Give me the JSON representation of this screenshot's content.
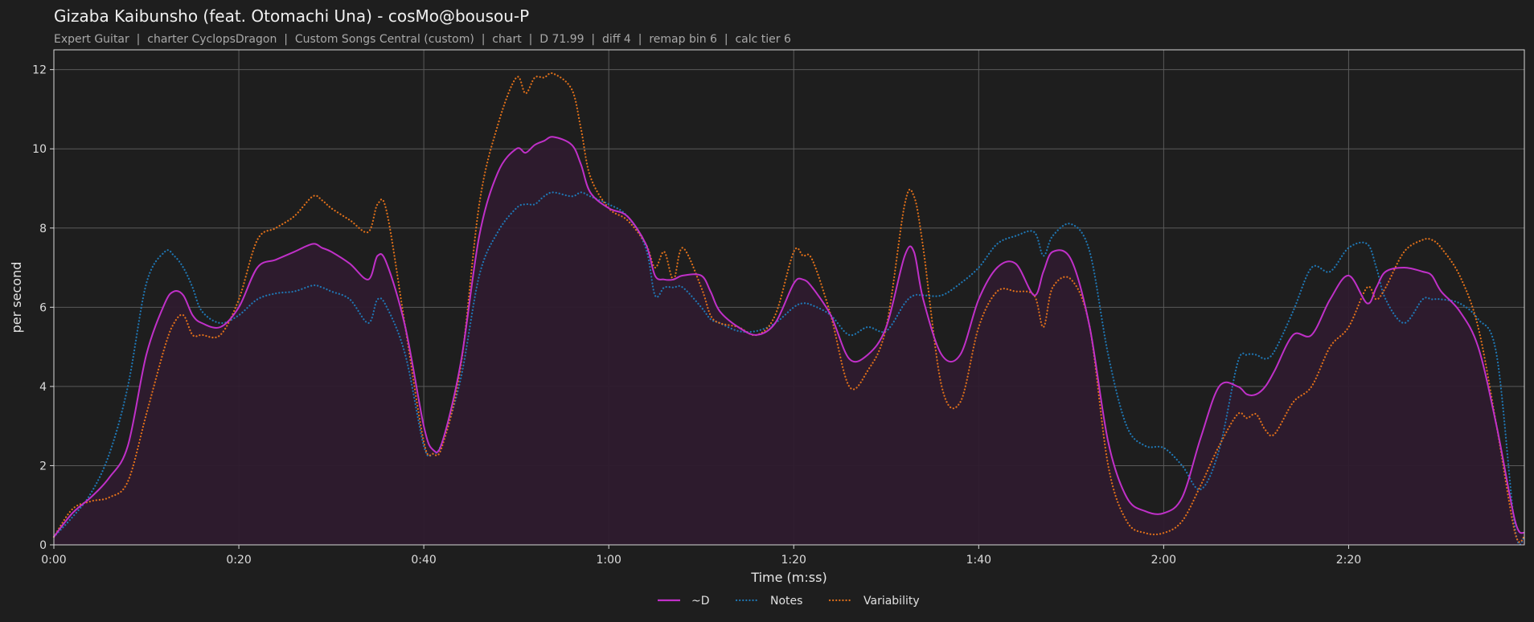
{
  "title": "Gizaba Kaibunsho (feat. Otomachi Una) - cosMo@bousou-P",
  "subtitle": "Expert Guitar  |  charter CyclopsDragon  |  Custom Songs Central (custom)  |  chart  |  D 71.99  |  diff 4  |  remap bin 6  |  calc tier 6",
  "colors": {
    "background": "#1e1e1e",
    "grid": "#5a5a5a",
    "d": "#c030c8",
    "notes": "#1f77b4",
    "variability": "#e0701a",
    "fill": "#2e1b2e"
  },
  "chart_data": {
    "type": "line",
    "xlabel": "Time (m:ss)",
    "ylabel": "per second",
    "xlim": [
      0,
      159
    ],
    "ylim": [
      0,
      12.5
    ],
    "grid": true,
    "legend_position": "bottom-center",
    "x_ticks": [
      {
        "value": 0,
        "label": "0:00"
      },
      {
        "value": 20,
        "label": "0:20"
      },
      {
        "value": 40,
        "label": "0:40"
      },
      {
        "value": 60,
        "label": "1:00"
      },
      {
        "value": 80,
        "label": "1:20"
      },
      {
        "value": 100,
        "label": "1:40"
      },
      {
        "value": 120,
        "label": "2:00"
      },
      {
        "value": 140,
        "label": "2:20"
      }
    ],
    "y_ticks": [
      {
        "value": 0,
        "label": "0"
      },
      {
        "value": 2,
        "label": "2"
      },
      {
        "value": 4,
        "label": "4"
      },
      {
        "value": 6,
        "label": "6"
      },
      {
        "value": 8,
        "label": "8"
      },
      {
        "value": 10,
        "label": "10"
      },
      {
        "value": 12,
        "label": "12"
      }
    ],
    "series": [
      {
        "name": "~D",
        "style": "solid",
        "filled": true,
        "x": [
          0,
          2,
          4,
          6,
          8,
          10,
          12,
          13,
          14,
          15,
          16,
          18,
          20,
          22,
          24,
          26,
          28,
          29,
          30,
          32,
          34,
          35,
          36,
          38,
          40,
          41,
          42,
          44,
          46,
          48,
          50,
          51,
          52,
          53,
          54,
          56,
          57,
          58,
          60,
          62,
          64,
          65,
          66,
          67,
          68,
          70,
          71,
          72,
          74,
          76,
          78,
          80,
          81,
          82,
          84,
          86,
          88,
          90,
          92,
          93,
          94,
          96,
          98,
          100,
          102,
          104,
          106,
          107,
          108,
          110,
          112,
          114,
          116,
          118,
          120,
          122,
          124,
          126,
          128,
          129,
          130,
          131,
          132,
          134,
          136,
          138,
          140,
          142,
          143,
          144,
          146,
          148,
          149,
          150,
          152,
          154,
          156,
          158,
          159
        ],
        "y": [
          0.2,
          0.8,
          1.2,
          1.7,
          2.5,
          4.8,
          6.1,
          6.4,
          6.3,
          5.8,
          5.6,
          5.5,
          6.0,
          7.0,
          7.2,
          7.4,
          7.6,
          7.5,
          7.4,
          7.1,
          6.7,
          7.3,
          7.1,
          5.5,
          3.0,
          2.4,
          2.6,
          4.6,
          7.8,
          9.4,
          10.0,
          9.9,
          10.1,
          10.2,
          10.3,
          10.1,
          9.6,
          8.9,
          8.5,
          8.3,
          7.6,
          6.8,
          6.7,
          6.7,
          6.8,
          6.8,
          6.4,
          5.9,
          5.5,
          5.3,
          5.6,
          6.6,
          6.7,
          6.5,
          5.8,
          4.7,
          4.8,
          5.5,
          7.3,
          7.4,
          6.2,
          4.8,
          4.8,
          6.2,
          7.0,
          7.1,
          6.3,
          6.9,
          7.4,
          7.2,
          5.5,
          2.6,
          1.2,
          0.85,
          0.8,
          1.2,
          2.7,
          4.0,
          4.0,
          3.8,
          3.8,
          4.0,
          4.4,
          5.3,
          5.3,
          6.2,
          6.8,
          6.1,
          6.5,
          6.9,
          7.0,
          6.9,
          6.8,
          6.4,
          5.9,
          5.0,
          3.0,
          0.6,
          0.3
        ]
      },
      {
        "name": "Notes",
        "style": "dotted",
        "filled": false,
        "x": [
          0,
          2,
          4,
          6,
          8,
          10,
          12,
          13,
          14,
          15,
          16,
          18,
          20,
          22,
          24,
          26,
          28,
          29,
          30,
          32,
          34,
          35,
          36,
          38,
          40,
          41,
          42,
          44,
          46,
          48,
          50,
          51,
          52,
          53,
          54,
          56,
          57,
          58,
          60,
          62,
          64,
          65,
          66,
          67,
          68,
          70,
          71,
          72,
          74,
          76,
          78,
          80,
          81,
          82,
          84,
          86,
          88,
          90,
          92,
          93,
          94,
          96,
          98,
          100,
          102,
          104,
          106,
          107,
          108,
          110,
          112,
          114,
          116,
          118,
          120,
          122,
          124,
          126,
          128,
          129,
          130,
          131,
          132,
          134,
          136,
          138,
          140,
          142,
          143,
          144,
          146,
          148,
          149,
          150,
          152,
          154,
          156,
          158,
          159
        ],
        "y": [
          0.2,
          0.7,
          1.3,
          2.3,
          4.0,
          6.6,
          7.4,
          7.3,
          7.0,
          6.5,
          5.9,
          5.6,
          5.8,
          6.2,
          6.35,
          6.4,
          6.55,
          6.5,
          6.4,
          6.2,
          5.6,
          6.2,
          6.0,
          4.8,
          2.5,
          2.3,
          2.6,
          4.2,
          6.8,
          7.9,
          8.5,
          8.6,
          8.6,
          8.8,
          8.9,
          8.8,
          8.9,
          8.8,
          8.6,
          8.3,
          7.5,
          6.3,
          6.5,
          6.5,
          6.5,
          6.0,
          5.7,
          5.6,
          5.4,
          5.4,
          5.6,
          6.0,
          6.1,
          6.05,
          5.8,
          5.3,
          5.5,
          5.4,
          6.1,
          6.3,
          6.3,
          6.3,
          6.6,
          7.0,
          7.6,
          7.8,
          7.9,
          7.3,
          7.8,
          8.1,
          7.4,
          4.8,
          3.0,
          2.5,
          2.45,
          2.0,
          1.4,
          2.4,
          4.6,
          4.8,
          4.8,
          4.7,
          4.9,
          5.9,
          7.0,
          6.9,
          7.5,
          7.6,
          7.0,
          6.2,
          5.6,
          6.2,
          6.2,
          6.2,
          6.1,
          5.7,
          4.8,
          0.4,
          0.2
        ]
      },
      {
        "name": "Variability",
        "style": "dotted",
        "filled": false,
        "x": [
          0,
          2,
          4,
          6,
          8,
          10,
          12,
          13,
          14,
          15,
          16,
          18,
          20,
          22,
          24,
          26,
          28,
          29,
          30,
          32,
          34,
          35,
          36,
          38,
          40,
          41,
          42,
          44,
          46,
          48,
          50,
          51,
          52,
          53,
          54,
          56,
          57,
          58,
          60,
          62,
          64,
          65,
          66,
          67,
          68,
          70,
          71,
          72,
          74,
          76,
          78,
          80,
          81,
          82,
          84,
          86,
          88,
          90,
          92,
          93,
          94,
          96,
          98,
          100,
          102,
          104,
          106,
          107,
          108,
          110,
          112,
          114,
          116,
          118,
          120,
          122,
          124,
          126,
          128,
          129,
          130,
          131,
          132,
          134,
          136,
          138,
          140,
          142,
          143,
          144,
          146,
          148,
          149,
          150,
          152,
          154,
          156,
          158,
          159
        ],
        "y": [
          0.2,
          0.9,
          1.1,
          1.2,
          1.6,
          3.3,
          5.0,
          5.6,
          5.8,
          5.3,
          5.3,
          5.3,
          6.2,
          7.7,
          8.0,
          8.3,
          8.8,
          8.7,
          8.5,
          8.2,
          7.9,
          8.6,
          8.4,
          5.5,
          2.6,
          2.3,
          2.5,
          4.5,
          8.6,
          10.6,
          11.8,
          11.4,
          11.8,
          11.8,
          11.9,
          11.5,
          10.5,
          9.3,
          8.5,
          8.2,
          7.6,
          7.0,
          7.4,
          6.7,
          7.5,
          6.5,
          5.8,
          5.6,
          5.5,
          5.3,
          5.8,
          7.4,
          7.3,
          7.2,
          5.8,
          4.0,
          4.4,
          5.5,
          8.6,
          8.8,
          7.5,
          4.0,
          3.6,
          5.5,
          6.4,
          6.4,
          6.3,
          5.5,
          6.5,
          6.7,
          5.5,
          2.0,
          0.6,
          0.3,
          0.3,
          0.6,
          1.5,
          2.5,
          3.3,
          3.2,
          3.3,
          2.9,
          2.8,
          3.6,
          4.0,
          5.0,
          5.5,
          6.5,
          6.2,
          6.5,
          7.4,
          7.7,
          7.7,
          7.5,
          6.8,
          5.5,
          3.0,
          0.3,
          0.2
        ]
      }
    ]
  }
}
